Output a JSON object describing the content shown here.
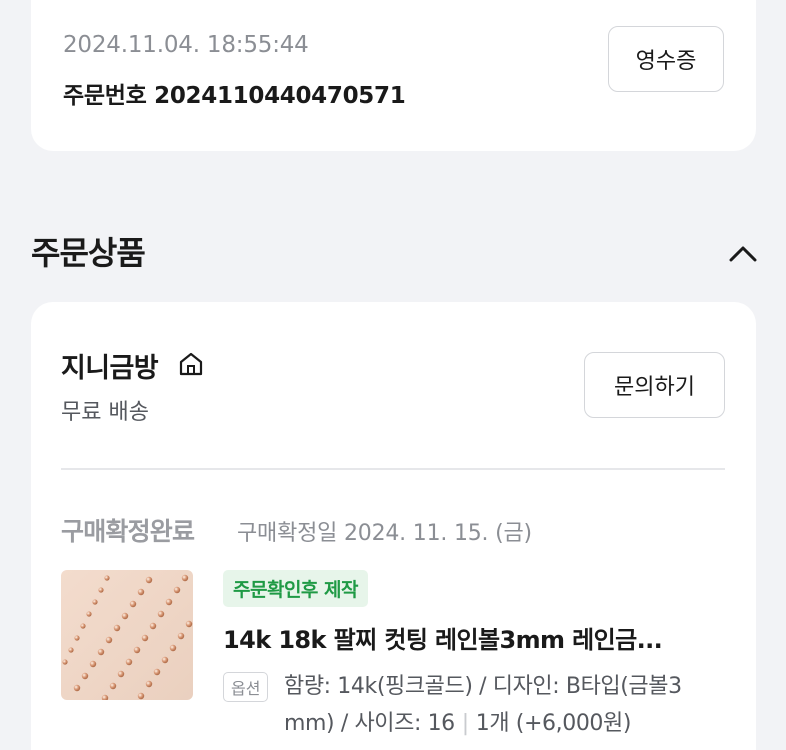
{
  "order": {
    "datetime": "2024.11.04. 18:55:44",
    "order_number": "주문번호 2024110440470571",
    "receipt_label": "영수증"
  },
  "section": {
    "title": "주문상품",
    "collapse_icon": "chevron-up-icon"
  },
  "store": {
    "name": "지니금방",
    "home_icon": "home-icon",
    "shipping": "무료 배송",
    "inquiry_label": "문의하기"
  },
  "item": {
    "status": "구매확정완료",
    "confirm_date": "구매확정일 2024. 11. 15. (금)",
    "tag": "주문확인후 제작",
    "name": "14k 18k 팔찌 컷팅 레인볼3mm 레인금...",
    "option_label": "옵션",
    "option_line1": "함량: 14k(핑크골드) / 디자인: B타입(금볼3",
    "option_line2": "mm) / 사이즈: 16",
    "quantity": "1개 (+6,000원)"
  },
  "colors": {
    "page_bg": "#f2f3f6",
    "card_bg": "#ffffff",
    "tag_bg": "#e7f5ea",
    "tag_text": "#1f9a45",
    "muted_text": "#8b8e94"
  }
}
